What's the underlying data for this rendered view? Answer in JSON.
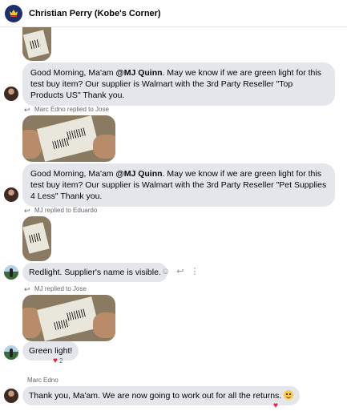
{
  "header": {
    "title": "Christian Perry (Kobe's Corner)",
    "avatar_icon": "crown-shield-icon"
  },
  "messages": [
    {
      "kind": "image-and-text",
      "sender": "Jose",
      "text_prefix": "Good Morning, Ma'am ",
      "mention": "@MJ Quinn",
      "text_suffix": ". May we know if we are green light for this test buy item? Our supplier is Walmart with the 3rd Party Reseller \"Top Products US\" Thank you."
    },
    {
      "kind": "image-and-text",
      "reply_label": "Marc Edno replied to Jose",
      "sender": "Jose",
      "text_prefix": "Good Morning, Ma'am ",
      "mention": "@MJ Quinn",
      "text_suffix": ". May we know if we are green light for this test buy item? Our supplier is Walmart with the 3rd Party Reseller \"Pet Supplies 4 Less\" Thank you."
    },
    {
      "kind": "reply",
      "reply_label": "MJ replied to Eduardo",
      "sender": "MJ",
      "text": "Redlight. Supplier's name is visible."
    },
    {
      "kind": "reply",
      "reply_label": "MJ replied to Jose",
      "sender": "MJ",
      "text": "Green light!",
      "reaction_count": "2"
    },
    {
      "kind": "text",
      "sender_name": "Marc Edno",
      "text": "Thank you, Ma'am. We are now going to work out for all the returns.",
      "emoji": "grinning-face-emoji"
    }
  ],
  "colors": {
    "bubble": "#e4e6eb",
    "heart": "#e41e3f",
    "meta": "#65676b"
  }
}
